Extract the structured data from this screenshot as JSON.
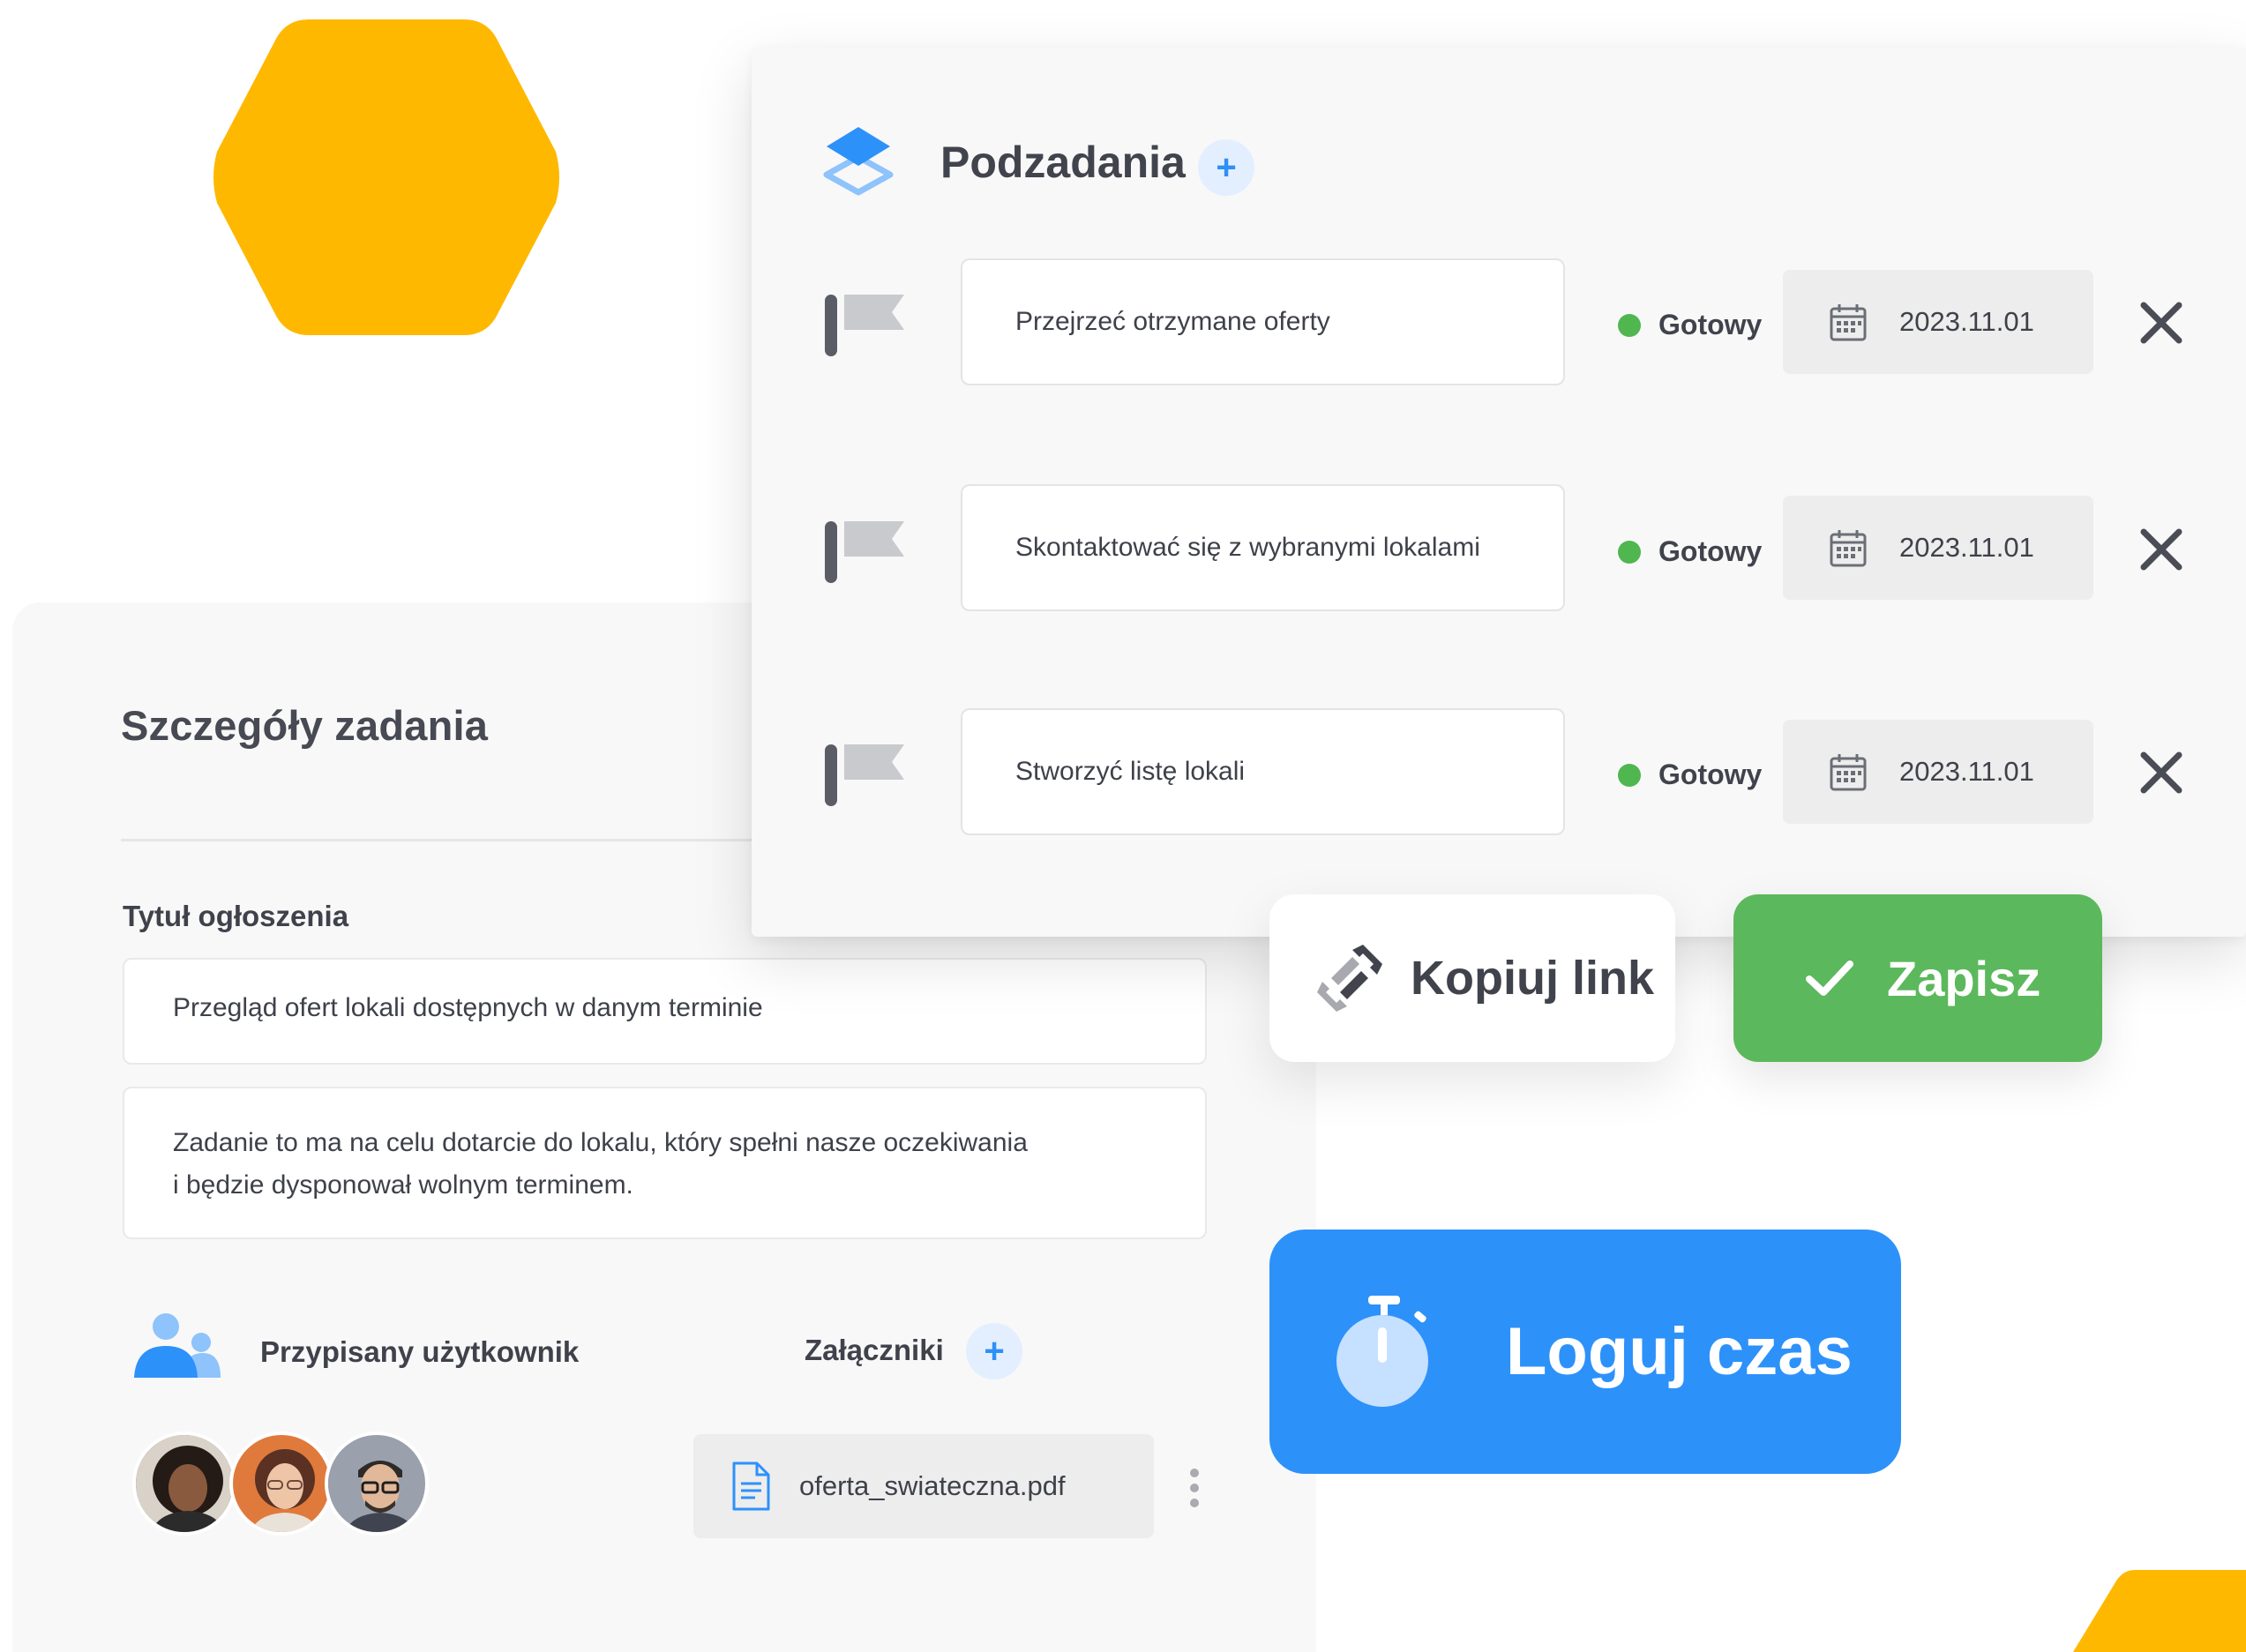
{
  "colors": {
    "hexagon": "#FFB800",
    "accent_blue": "#2D91FA",
    "status_green": "#4FB650",
    "save_green": "#5CB85C"
  },
  "details": {
    "title": "Szczegóły zadania",
    "ad_title_label": "Tytuł ogłoszenia",
    "ad_title_value": "Przegląd ofert lokali dostępnych w danym terminie",
    "description_line1": "Zadanie to ma na celu dotarcie do lokalu, który spełni nasze oczekiwania",
    "description_line2": "i będzie dysponował wolnym terminem.",
    "assigned_label": "Przypisany użytkownik",
    "attachments_label": "Załączniki",
    "attachment_file": "oferta_swiateczna.pdf",
    "add_symbol": "+"
  },
  "subtasks": {
    "title": "Podzadania",
    "add_symbol": "+",
    "items": [
      {
        "name": "Przejrzeć otrzymane oferty",
        "status": "Gotowy",
        "date": "2023.11.01"
      },
      {
        "name": "Skontaktować się z wybranymi lokalami",
        "status": "Gotowy",
        "date": "2023.11.01"
      },
      {
        "name": "Stworzyć listę lokali",
        "status": "Gotowy",
        "date": "2023.11.01"
      }
    ]
  },
  "actions": {
    "copy_link": "Kopiuj link",
    "save": "Zapisz",
    "log_time": "Loguj czas"
  },
  "icons": [
    "layers-icon",
    "flag-icon",
    "calendar-icon",
    "close-icon",
    "link-icon",
    "check-icon",
    "stopwatch-icon",
    "users-icon",
    "document-icon",
    "more-vertical-icon"
  ]
}
